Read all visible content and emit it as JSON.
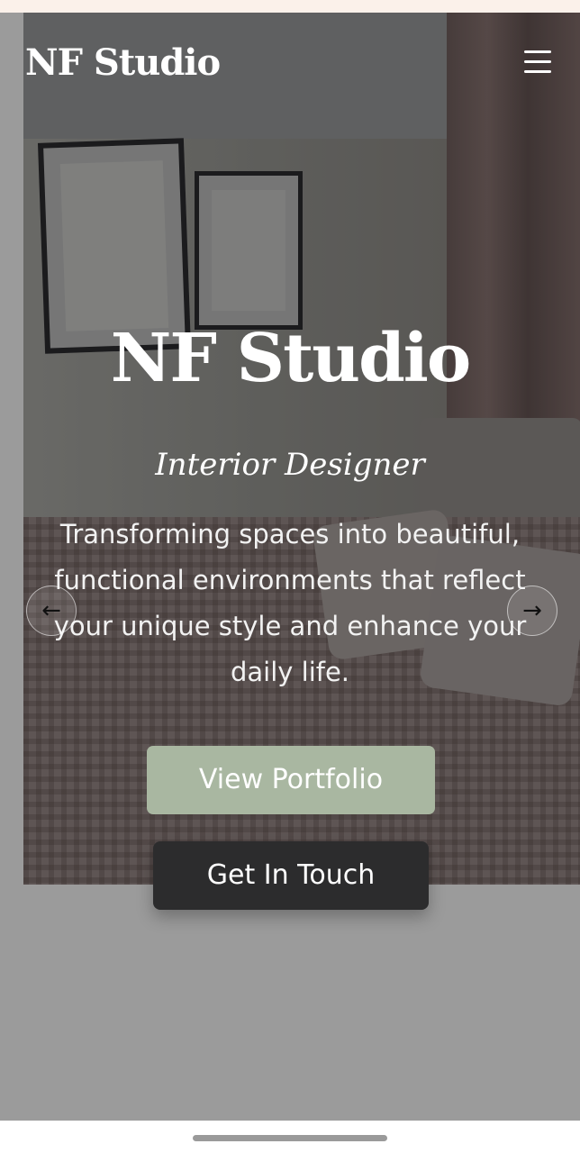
{
  "header": {
    "brand": "NF Studio",
    "menu_icon": "hamburger-menu-icon"
  },
  "hero": {
    "title": "NF Studio",
    "subtitle": "Interior Designer",
    "description": "Transforming spaces into beautiful, functional environments that reflect your unique style and enhance your daily life.",
    "prev_icon": "arrow-left-icon",
    "next_icon": "arrow-right-icon",
    "prev_glyph": "←",
    "next_glyph": "→"
  },
  "actions": {
    "portfolio_label": "View Portfolio",
    "contact_label": "Get In Touch"
  },
  "colors": {
    "accent": "#a9b7a1",
    "dark_button": "#2c2c2d",
    "top_strip": "#fbf1ea",
    "page_background": "#9b9b9b"
  }
}
